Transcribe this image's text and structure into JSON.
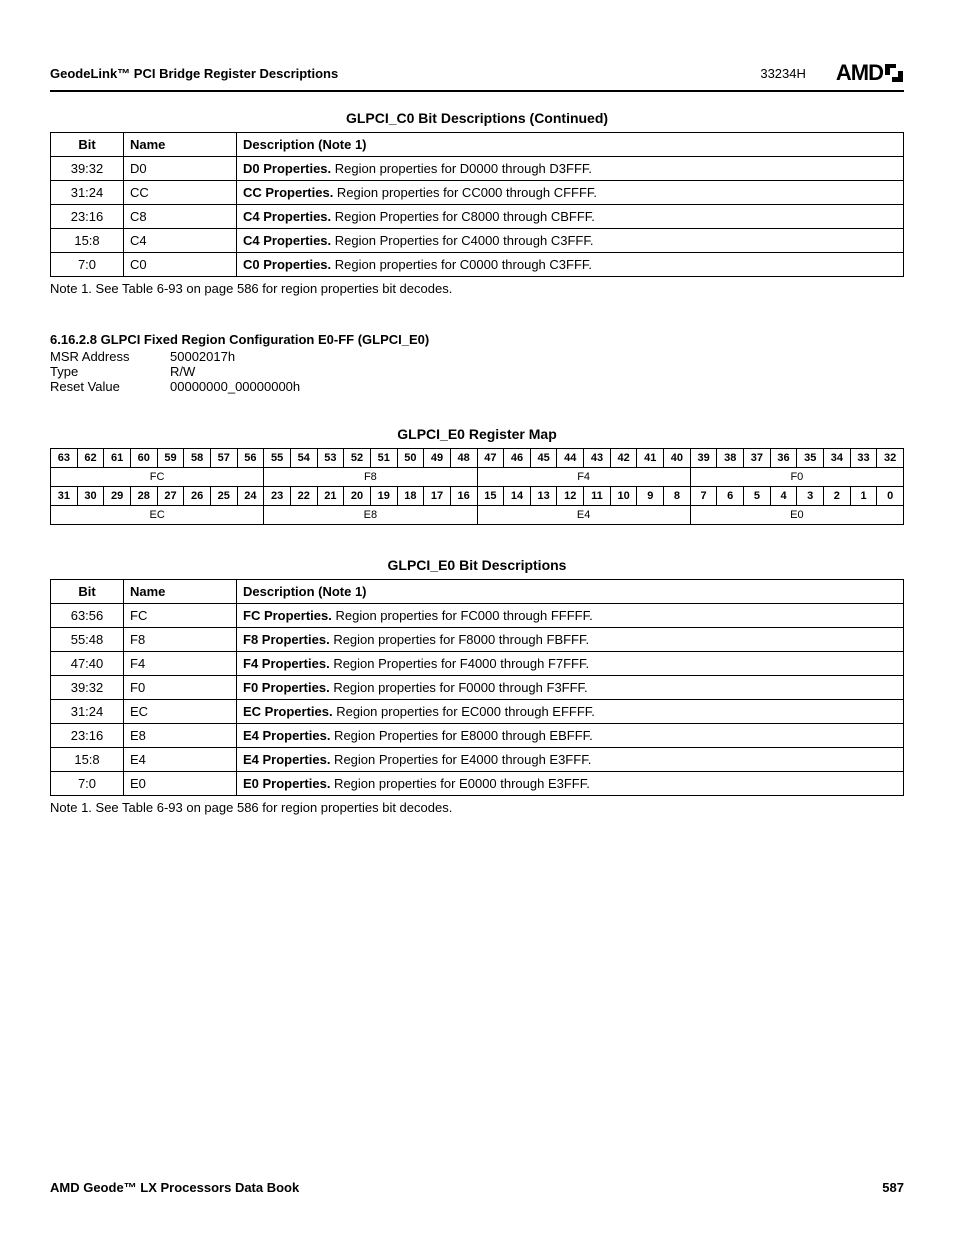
{
  "header": {
    "title": "GeodeLink™ PCI Bridge Register Descriptions",
    "docnum": "33234H",
    "logo": "AMD"
  },
  "table1": {
    "title": "GLPCI_C0 Bit Descriptions  (Continued)",
    "headers": {
      "bit": "Bit",
      "name": "Name",
      "desc": "Description (Note 1)"
    },
    "rows": [
      {
        "bit": "39:32",
        "name": "D0",
        "strong": "D0 Properties.",
        "rest": " Region properties for D0000 through D3FFF."
      },
      {
        "bit": "31:24",
        "name": "CC",
        "strong": "CC Properties.",
        "rest": " Region properties for CC000 through CFFFF."
      },
      {
        "bit": "23:16",
        "name": "C8",
        "strong": "C4 Properties.",
        "rest": " Region Properties for C8000 through CBFFF."
      },
      {
        "bit": "15:8",
        "name": "C4",
        "strong": "C4 Properties.",
        "rest": " Region Properties for C4000 through C3FFF."
      },
      {
        "bit": "7:0",
        "name": "C0",
        "strong": "C0 Properties.",
        "rest": " Region properties for C0000 through C3FFF."
      }
    ],
    "note": "Note 1.   See Table 6-93 on page 586 for region properties bit decodes."
  },
  "section": {
    "heading": "6.16.2.8   GLPCI Fixed Region Configuration E0-FF (GLPCI_E0)",
    "meta": [
      {
        "label": "MSR Address",
        "value": "50002017h"
      },
      {
        "label": "Type",
        "value": "R/W"
      },
      {
        "label": "Reset Value",
        "value": "00000000_00000000h"
      }
    ]
  },
  "regmap": {
    "title": "GLPCI_E0 Register Map",
    "rowHighBits": [
      "63",
      "62",
      "61",
      "60",
      "59",
      "58",
      "57",
      "56",
      "55",
      "54",
      "53",
      "52",
      "51",
      "50",
      "49",
      "48",
      "47",
      "46",
      "45",
      "44",
      "43",
      "42",
      "41",
      "40",
      "39",
      "38",
      "37",
      "36",
      "35",
      "34",
      "33",
      "32"
    ],
    "rowHighFields": [
      {
        "label": "FC",
        "span": 8
      },
      {
        "label": "F8",
        "span": 8
      },
      {
        "label": "F4",
        "span": 8
      },
      {
        "label": "F0",
        "span": 8
      }
    ],
    "rowLowBits": [
      "31",
      "30",
      "29",
      "28",
      "27",
      "26",
      "25",
      "24",
      "23",
      "22",
      "21",
      "20",
      "19",
      "18",
      "17",
      "16",
      "15",
      "14",
      "13",
      "12",
      "11",
      "10",
      "9",
      "8",
      "7",
      "6",
      "5",
      "4",
      "3",
      "2",
      "1",
      "0"
    ],
    "rowLowFields": [
      {
        "label": "EC",
        "span": 8
      },
      {
        "label": "E8",
        "span": 8
      },
      {
        "label": "E4",
        "span": 8
      },
      {
        "label": "E0",
        "span": 8
      }
    ]
  },
  "table2": {
    "title": "GLPCI_E0 Bit Descriptions",
    "headers": {
      "bit": "Bit",
      "name": "Name",
      "desc": "Description (Note 1)"
    },
    "rows": [
      {
        "bit": "63:56",
        "name": "FC",
        "strong": "FC Properties.",
        "rest": " Region properties for FC000 through FFFFF."
      },
      {
        "bit": "55:48",
        "name": "F8",
        "strong": "F8 Properties.",
        "rest": " Region properties for F8000 through FBFFF."
      },
      {
        "bit": "47:40",
        "name": "F4",
        "strong": "F4 Properties.",
        "rest": " Region Properties for F4000 through F7FFF."
      },
      {
        "bit": "39:32",
        "name": "F0",
        "strong": "F0 Properties.",
        "rest": " Region properties for F0000 through F3FFF."
      },
      {
        "bit": "31:24",
        "name": "EC",
        "strong": "EC Properties.",
        "rest": " Region properties for EC000 through EFFFF."
      },
      {
        "bit": "23:16",
        "name": "E8",
        "strong": "E4 Properties.",
        "rest": " Region Properties for E8000 through EBFFF."
      },
      {
        "bit": "15:8",
        "name": "E4",
        "strong": "E4 Properties.",
        "rest": " Region Properties for E4000 through E3FFF."
      },
      {
        "bit": "7:0",
        "name": "E0",
        "strong": "E0 Properties.",
        "rest": " Region properties for E0000 through E3FFF."
      }
    ],
    "note": "Note 1.   See Table 6-93 on page 586 for region properties bit decodes."
  },
  "footer": {
    "left": "AMD Geode™ LX Processors Data Book",
    "right": "587"
  }
}
